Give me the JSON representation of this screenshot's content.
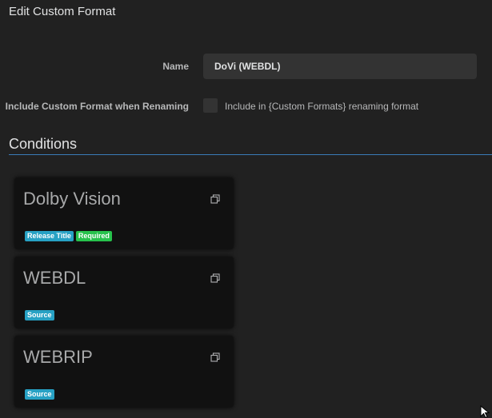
{
  "modal": {
    "title": "Edit Custom Format"
  },
  "form": {
    "name_label": "Name",
    "name_value": "DoVi (WEBDL)",
    "rename_label": "Include Custom Format when Renaming",
    "rename_checked": false,
    "rename_help": "Include in {Custom Formats} renaming format"
  },
  "conditions": {
    "section_title": "Conditions",
    "cards": [
      {
        "title": "Dolby Vision",
        "tags": [
          {
            "label": "Release Title",
            "color": "#27a1c4"
          },
          {
            "label": "Required",
            "color": "#27c24c"
          }
        ]
      },
      {
        "title": "WEBDL",
        "tags": [
          {
            "label": "Source",
            "color": "#27a1c4"
          }
        ]
      },
      {
        "title": "WEBRIP",
        "tags": [
          {
            "label": "Source",
            "color": "#27a1c4"
          }
        ]
      }
    ]
  },
  "icons": {
    "copy": "copy-icon",
    "cursor": "mouse-pointer-icon"
  }
}
